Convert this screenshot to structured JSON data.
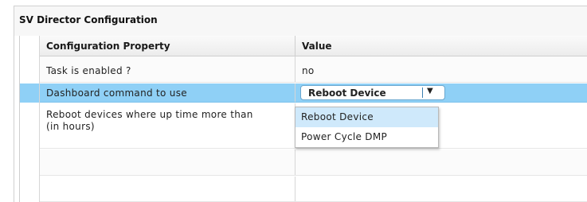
{
  "panel": {
    "title": "SV Director Configuration"
  },
  "grid": {
    "headers": {
      "property": "Configuration Property",
      "value": "Value"
    },
    "rows": [
      {
        "property": "Task is enabled ?",
        "value": "no"
      },
      {
        "property": "Dashboard command to use",
        "value": "Reboot Device"
      },
      {
        "property": "Reboot devices where up time more than (in hours)",
        "property_line1": "Reboot devices where up time more than",
        "property_line2": "(in hours)",
        "value": ""
      }
    ]
  },
  "dropdown": {
    "selected": "Reboot Device",
    "options": [
      "Reboot Device",
      "Power Cycle DMP"
    ],
    "highlight_color": "#cfe9fb"
  },
  "colors": {
    "selected_row": "#8fd0f6",
    "select_border": "#6aa7cf"
  }
}
